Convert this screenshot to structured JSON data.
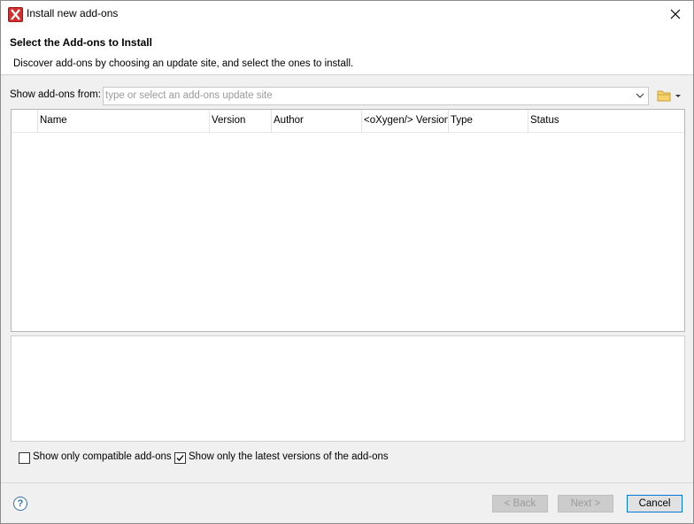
{
  "window": {
    "title": "Install new add-ons"
  },
  "header": {
    "title": "Select the Add-ons to Install",
    "description": "Discover add-ons by choosing an update site, and select the ones to install."
  },
  "site": {
    "label": "Show add-ons from:",
    "placeholder": "type or select an add-ons update site",
    "value": ""
  },
  "table": {
    "columns": [
      "Name",
      "Version",
      "Author",
      "<oXygen/> Version",
      "Type",
      "Status"
    ],
    "rows": []
  },
  "options": {
    "compatible_label": "Show only compatible add-ons",
    "compatible_checked": false,
    "latest_label": "Show only the latest versions of the add-ons",
    "latest_checked": true
  },
  "buttons": {
    "back": "< Back",
    "next": "Next >",
    "cancel": "Cancel",
    "help": "?"
  }
}
